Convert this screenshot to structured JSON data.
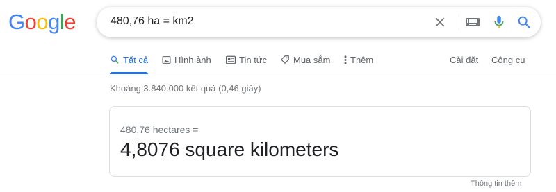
{
  "logo": {
    "letters": [
      "G",
      "o",
      "o",
      "g",
      "l",
      "e"
    ],
    "colors": [
      "#4285F4",
      "#EA4335",
      "#FBBC05",
      "#4285F4",
      "#34A853",
      "#EA4335"
    ]
  },
  "search": {
    "query": "480,76 ha = km2",
    "icons": [
      "close-icon",
      "keyboard-icon",
      "microphone-icon",
      "search-icon"
    ]
  },
  "tabs": [
    {
      "label": "Tất cả",
      "icon": "search-icon",
      "active": true
    },
    {
      "label": "Hình ảnh",
      "icon": "image-icon",
      "active": false
    },
    {
      "label": "Tin tức",
      "icon": "news-icon",
      "active": false
    },
    {
      "label": "Mua sắm",
      "icon": "tag-icon",
      "active": false
    },
    {
      "label": "Thêm",
      "icon": "more-vert-icon",
      "active": false
    }
  ],
  "tools": {
    "settings_label": "Cài đặt",
    "tools_label": "Công cụ"
  },
  "result_stats": "Khoảng 3.840.000 kết quả (0,46 giây)",
  "converter": {
    "from_text": "480,76 hectares =",
    "to_text": "4,8076 square kilometers"
  },
  "more_info_label": "Thông tin thêm",
  "colors": {
    "accent": "#1a73e8",
    "text_secondary": "#70757a",
    "border": "#dadce0"
  }
}
